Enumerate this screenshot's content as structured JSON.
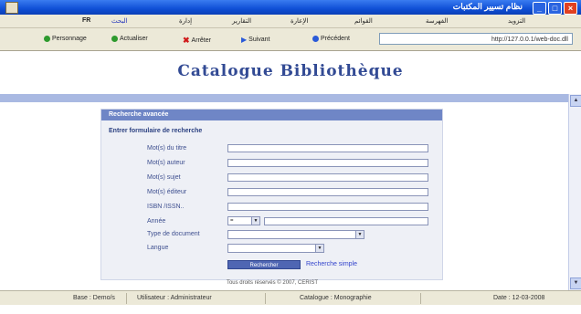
{
  "window": {
    "title": "نظام تسيير المكتبات"
  },
  "menu": {
    "lang": "FR",
    "items": [
      "البحث",
      "إدارة",
      "التقارير",
      "الإعارة",
      "القوائم",
      "الفهرسة",
      "التزويد"
    ]
  },
  "toolbar": {
    "home": "Personnage",
    "refresh": "Actualiser",
    "stop": "Arrêter",
    "next": "Suivant",
    "prev": "Précédent",
    "address": "http://127.0.0.1/web-doc.dll"
  },
  "page": {
    "heading": "Catalogue Bibliothèque",
    "panel_title": "Recherche avancée",
    "instruction": "Entrer formulaire de recherche",
    "fields": [
      "Mot(s) du titre",
      "Mot(s) auteur",
      "Mot(s) sujet",
      "Mot(s) éditeur",
      "ISBN /ISSN..",
      "Année",
      "Type de document",
      "Langue"
    ],
    "year_operator": "=",
    "search_button": "Rechercher",
    "simple_link": "Recherche simple",
    "copyright": "Tous droits réservés © 2007, CERIST"
  },
  "status": {
    "base": "Base : Demo/s",
    "user": "Utilisateur : Administrateur",
    "catalog": "Catalogue : Monographie",
    "date": "Date : 12-03-2008"
  },
  "colors": {
    "accent": "#324a94",
    "panel_header": "#6f86c6",
    "band": "#a9b9e2",
    "link": "#3344cc"
  }
}
